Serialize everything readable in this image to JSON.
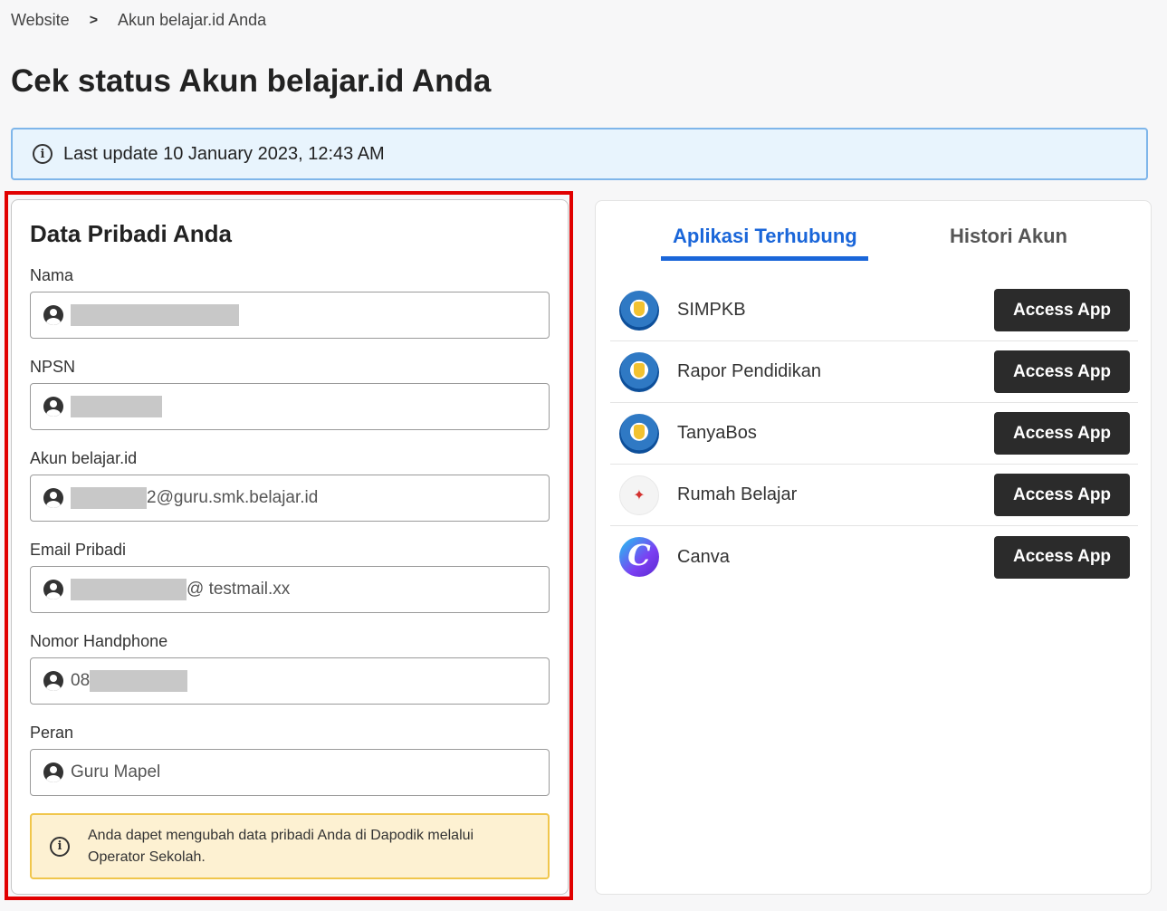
{
  "breadcrumb": {
    "items": [
      "Website",
      "Akun belajar.id Anda"
    ],
    "separator": ">"
  },
  "page_title": "Cek status Akun belajar.id Anda",
  "banner": {
    "text": "Last update 10 January 2023, 12:43 AM",
    "icon": "info-icon"
  },
  "personal": {
    "title": "Data Pribadi Anda",
    "fields": [
      {
        "label": "Nama",
        "value": ""
      },
      {
        "label": "NPSN",
        "value": ""
      },
      {
        "label": "Akun belajar.id",
        "value": "2@guru.smk.belajar.id"
      },
      {
        "label": "Email Pribadi",
        "value": "@ testmail.xx"
      },
      {
        "label": "Nomor Handphone",
        "value": "08"
      },
      {
        "label": "Peran",
        "value": "Guru Mapel"
      }
    ],
    "note": "Anda dapet mengubah data pribadi Anda di Dapodik melalui Operator Sekolah."
  },
  "apps": {
    "tabs": [
      {
        "label": "Aplikasi Terhubung",
        "active": true
      },
      {
        "label": "Histori Akun",
        "active": false
      }
    ],
    "items": [
      {
        "name": "SIMPKB",
        "button": "Access App",
        "logo": "kemdikbud-logo"
      },
      {
        "name": "Rapor Pendidikan",
        "button": "Access App",
        "logo": "kemdikbud-logo"
      },
      {
        "name": "TanyaBos",
        "button": "Access App",
        "logo": "kemdikbud-logo"
      },
      {
        "name": "Rumah Belajar",
        "button": "Access App",
        "logo": "rumah-belajar-logo"
      },
      {
        "name": "Canva",
        "button": "Access App",
        "logo": "canva-logo"
      }
    ]
  },
  "colors": {
    "accent": "#1a66d9",
    "highlight_frame": "#e10000",
    "banner_bg": "#e8f4fd",
    "note_bg": "#fdf1d2",
    "button_bg": "#2b2b2b"
  }
}
